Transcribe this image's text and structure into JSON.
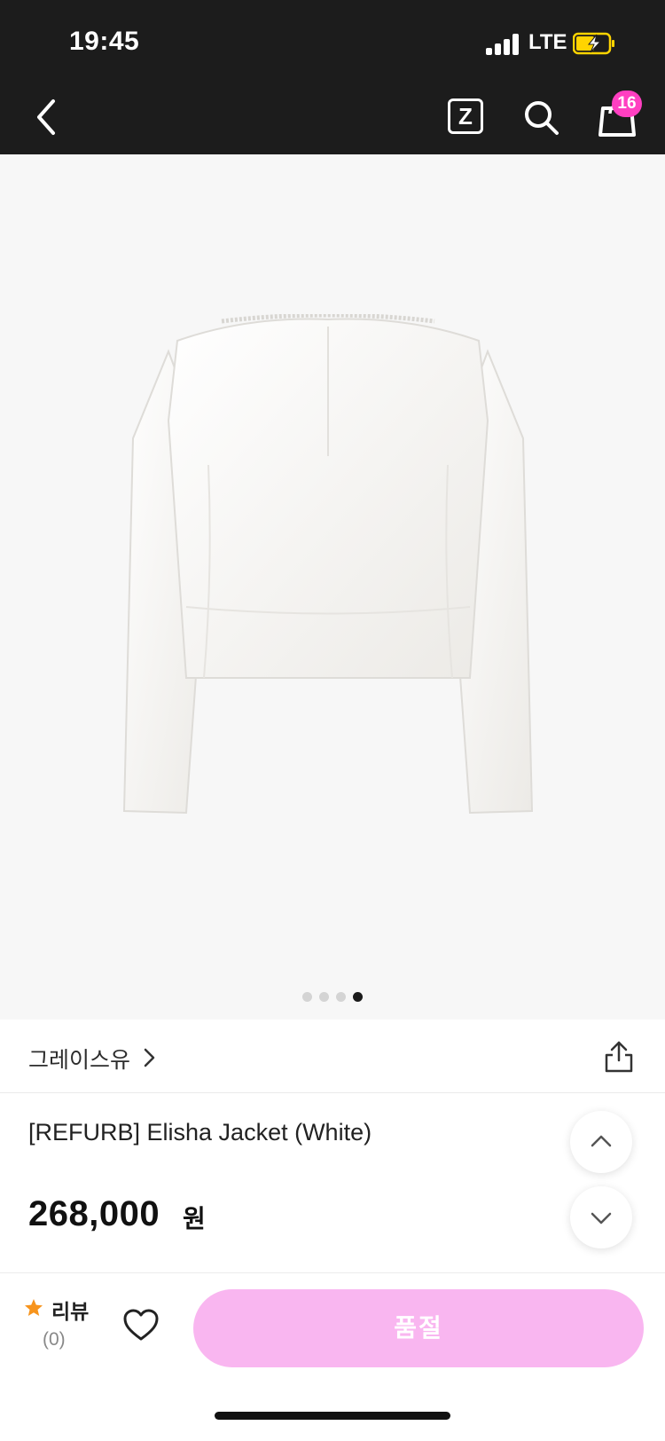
{
  "status_bar": {
    "time": "19:45",
    "network": "LTE",
    "signal_bars_filled": 4,
    "battery_charging": true
  },
  "header": {
    "back_icon": "chevron-left-icon",
    "z_label": "Z",
    "search_icon": "search-icon",
    "cart_icon": "shopping-bag-icon",
    "cart_count": "16",
    "badge_color": "#ff3fc1"
  },
  "gallery": {
    "image_subject": "white tweed jacket, back view",
    "page_count": 4,
    "active_page": 4
  },
  "product": {
    "brand": "그레이스유",
    "title": "[REFURB] Elisha Jacket (White)",
    "price": "268,000",
    "currency": "원"
  },
  "bottom_bar": {
    "review_label": "리뷰",
    "review_count": "(0)",
    "star_color": "#f7941d",
    "buy_button_label": "품절",
    "buy_button_color": "#f9b6f0"
  }
}
